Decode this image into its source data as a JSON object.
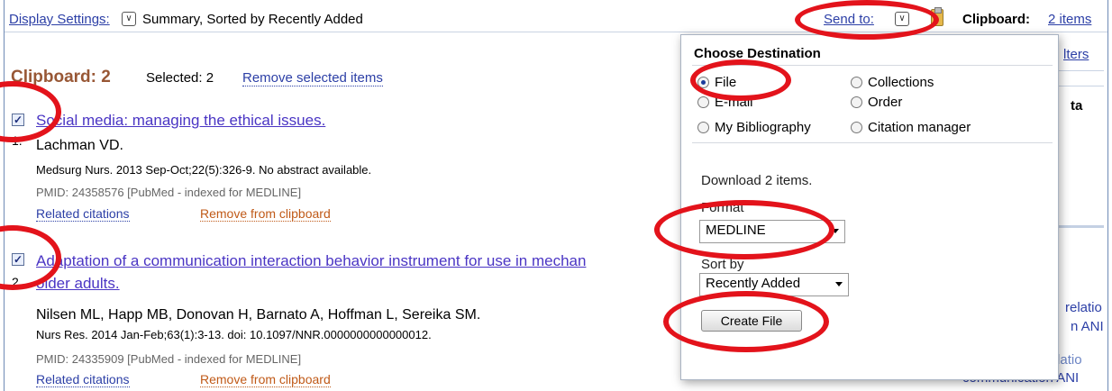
{
  "topbar": {
    "display_settings_label": "Display Settings:",
    "display_settings_value": "Summary, Sorted by Recently Added",
    "send_to_label": "Send to:",
    "clipboard_label": "Clipboard:",
    "clipboard_count": "2 items"
  },
  "clipboard": {
    "heading": "Clipboard: 2",
    "selected": "Selected: 2",
    "remove_selected": "Remove selected items"
  },
  "items": [
    {
      "number": "1.",
      "checked": true,
      "title": "Social media: managing the ethical issues.",
      "authors": "Lachman VD.",
      "journal": "Medsurg Nurs. 2013 Sep-Oct;22(5):326-9. No abstract available.",
      "pmid": "PMID: 24358576 [PubMed - indexed for MEDLINE]",
      "related": "Related citations",
      "remove": "Remove from clipboard"
    },
    {
      "number": "2.",
      "checked": true,
      "title_line1": "Adaptation of a communication interaction behavior instrument for use in mechan",
      "title_line2": "older adults.",
      "authors": "Nilsen ML, Happ MB, Donovan H, Barnato A, Hoffman L, Sereika SM.",
      "journal": "Nurs Res. 2014 Jan-Feb;63(1):3-13. doi: 10.1097/NNR.0000000000000012.",
      "pmid": "PMID: 24335909 [PubMed - indexed for MEDLINE]",
      "related": "Related citations",
      "remove": "Remove from clipboard"
    }
  ],
  "side_fragments": {
    "filters": "lters",
    "ta": "ta",
    "relatio1": "relatio",
    "n_and": "n ANI",
    "nurse_patient": "nurse-patient relatio",
    "communication": "communication ANI"
  },
  "popup": {
    "title": "Choose Destination",
    "destinations": [
      {
        "label": "File",
        "selected": true
      },
      {
        "label": "Collections",
        "selected": false
      },
      {
        "label": "E-mail",
        "selected": false
      },
      {
        "label": "Order",
        "selected": false
      },
      {
        "label": "My Bibliography",
        "selected": false
      },
      {
        "label": "Citation manager",
        "selected": false
      }
    ],
    "download_text": "Download 2 items.",
    "format_label": "Format",
    "format_value": "MEDLINE",
    "sort_label": "Sort by",
    "sort_value": "Recently Added",
    "create_button": "Create File"
  },
  "colors": {
    "link": "#2c3fa6",
    "title_link": "#4a35c4",
    "clipboard_heading": "#985735",
    "remove_link": "#c05a18",
    "annotation": "#e3131b"
  }
}
